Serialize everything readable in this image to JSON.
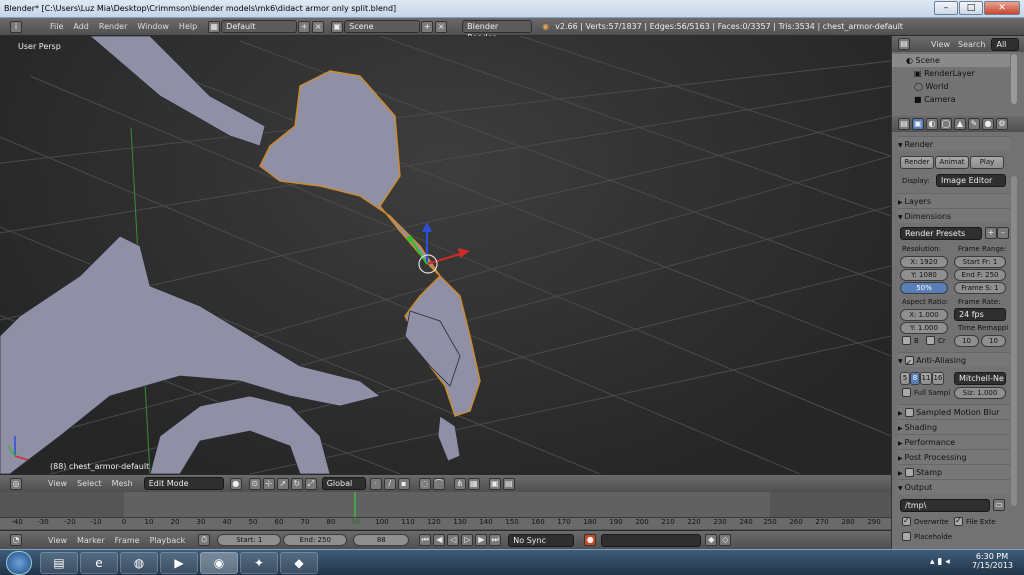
{
  "window": {
    "title": "Blender* [C:\\Users\\Luz Mia\\Desktop\\Crimmson\\blender models\\mk6\\didact armor only split.blend]",
    "min": "–",
    "max": "□",
    "close": "✕"
  },
  "topbar": {
    "menus": [
      "File",
      "Add",
      "Render",
      "Window",
      "Help"
    ],
    "layout": "Default",
    "scene": "Scene",
    "engine": "Blender Render",
    "stats": "v2.66 | Verts:57/1837 | Edges:56/5163 | Faces:0/3357 | Tris:3534 | chest_armor-default"
  },
  "viewport": {
    "view_label": "User Persp",
    "object_label": "(88) chest_armor-default"
  },
  "outliner": {
    "menu_view": "View",
    "menu_search": "Search",
    "filter": "All Sce",
    "rows": [
      "Scene",
      "RenderLayer",
      "World",
      "Camera"
    ]
  },
  "properties": {
    "render_header": "Render",
    "render_btn": "Render",
    "animation_btn": "Animat",
    "play_btn": "Play",
    "display_label": "Display:",
    "display_value": "Image Editor",
    "layers": "Layers",
    "dimensions": "Dimensions",
    "render_presets": "Render Presets",
    "resolution_label": "Resolution:",
    "frame_range_label": "Frame Range:",
    "res_x": "X: 1920",
    "res_y": "Y: 1080",
    "res_pct": "50%",
    "start_frame": "Start Fr: 1",
    "end_frame": "End F: 250",
    "frame_step": "Frame S: 1",
    "aspect_label": "Aspect Ratio:",
    "frame_rate_label": "Frame Rate:",
    "aspect_x": "X: 1.000",
    "aspect_y": "Y: 1.000",
    "fps": "24 fps",
    "time_remap": "Time Remappi",
    "remap_old": "10",
    "remap_new": "10",
    "border_b": "B",
    "border_cr": "Cr",
    "anti_aliasing": "Anti-Aliasing",
    "aa_samples": [
      "5",
      "8",
      "11",
      "16"
    ],
    "aa_filter": "Mitchell-Ne",
    "full_sample": "Full Sampl",
    "filter_size": "Siz: 1.000",
    "sampled_motion_blur": "Sampled Motion Blur",
    "shading": "Shading",
    "performance": "Performance",
    "post_processing": "Post Processing",
    "stamp": "Stamp",
    "output": "Output",
    "output_path": "/tmp\\",
    "overwrite": "Overwrite",
    "file_ext": "File Exte",
    "placeholders": "Placeholde"
  },
  "viewport_header": {
    "menus": [
      "View",
      "Select",
      "Mesh"
    ],
    "mode": "Edit Mode",
    "orientation": "Global"
  },
  "timeline": {
    "ticks": [
      "-40",
      "-30",
      "-20",
      "-10",
      "0",
      "10",
      "20",
      "30",
      "40",
      "50",
      "60",
      "70",
      "80",
      "90",
      "100",
      "110",
      "120",
      "130",
      "140",
      "150",
      "160",
      "170",
      "180",
      "190",
      "200",
      "210",
      "220",
      "230",
      "240",
      "250",
      "260",
      "270",
      "280",
      "290"
    ],
    "current_frame_marker": 88
  },
  "timeline_header": {
    "menus": [
      "View",
      "Marker",
      "Frame",
      "Playback"
    ],
    "start": "Start: 1",
    "end": "End: 250",
    "current": "88",
    "sync": "No Sync"
  },
  "taskbar": {
    "time": "6:30 PM",
    "date": "7/15/2013"
  }
}
